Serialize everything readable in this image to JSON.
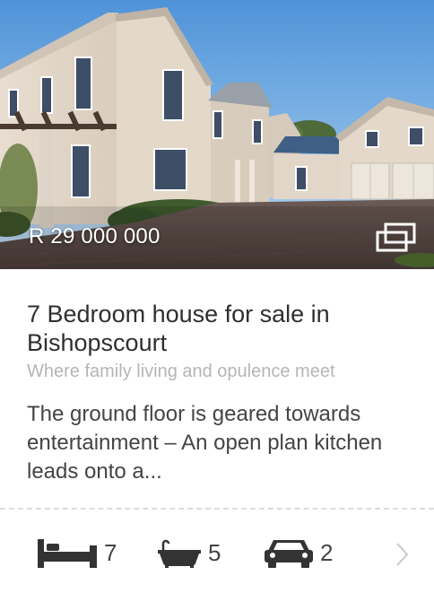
{
  "listing": {
    "price": "R 29 000 000",
    "title": "7 Bedroom house for sale in Bishopscourt",
    "subtitle": "Where family living and opulence meet",
    "description": "The ground floor is geared towards entertainment – An open plan kitchen leads onto a..."
  },
  "features": {
    "bedrooms": "7",
    "bathrooms": "5",
    "garages": "2"
  },
  "icons": {
    "gallery": "gallery-icon",
    "bed": "bed-icon",
    "bath": "bath-icon",
    "car": "car-icon",
    "next": "chevron-right-icon"
  },
  "colors": {
    "title": "#2f2f2f",
    "subtitle": "#b5b5b5",
    "body_text": "#444444",
    "divider": "#dcdcdc",
    "icon": "#333333"
  }
}
